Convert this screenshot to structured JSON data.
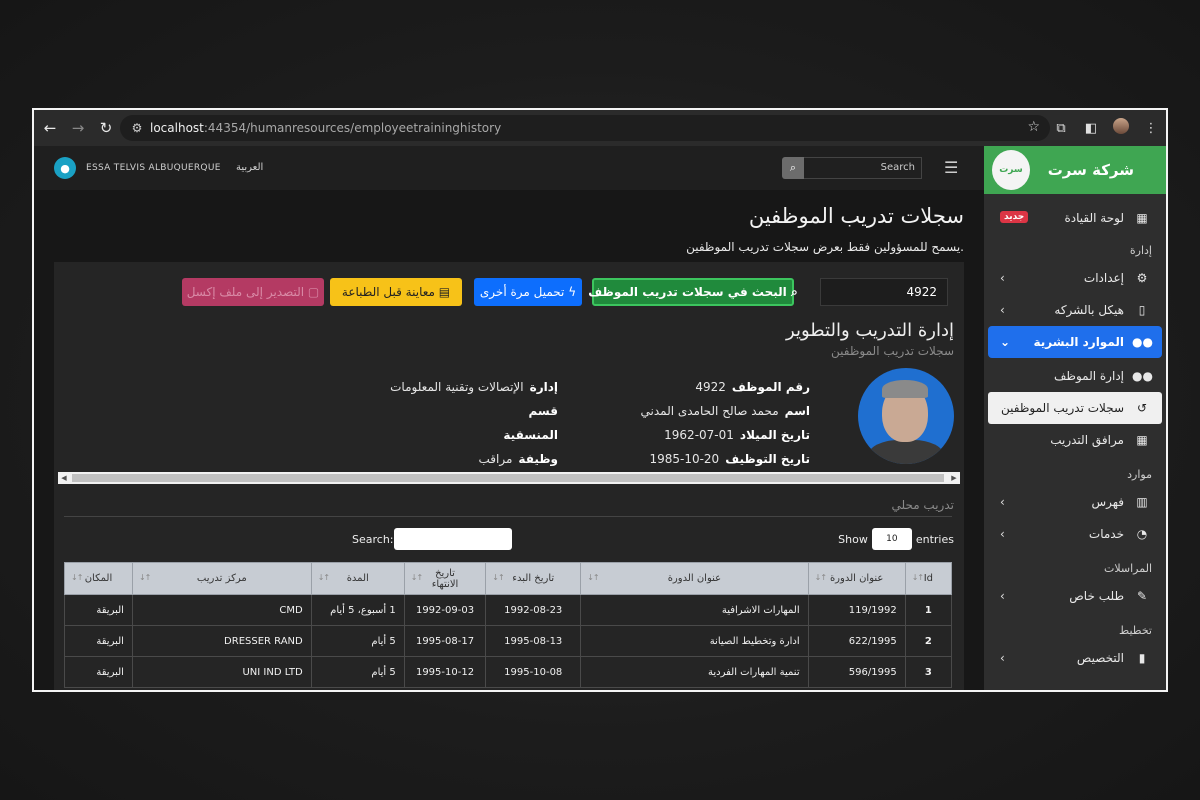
{
  "browser": {
    "url_host": "localhost",
    "url_path": ":44354/humanresources/employeetraininghistory"
  },
  "sidebar": {
    "brand": "شركة سرت",
    "logo_text": "سرت",
    "dashboard": {
      "label": "لوحة القيادة",
      "badge": "جديد"
    },
    "sections": {
      "admin": "إدارة",
      "resources": "موارد",
      "correspondence": "المراسلات",
      "planning": "تخطيط"
    },
    "items": {
      "settings": "إعدادات",
      "structure": "هيكل بالشركه",
      "hr": "الموارد البشرية",
      "employee_mgmt": "إدارة الموظف",
      "training_records": "سجلات تدريب الموظفين",
      "training_facilities": "مرافق التدريب",
      "index": "فهرس",
      "services": "خدمات",
      "special_request": "طلب خاص",
      "allocation": "التخصيص"
    }
  },
  "topnav": {
    "user_name": "ESSA TELVIS ALBUQUERQUE",
    "language": "العربية",
    "search_placeholder": "Search"
  },
  "page": {
    "title": "سجلات تدريب الموظفين",
    "subtitle": "يسمح للمسؤولين فقط بعرض سجلات تدريب الموظفين."
  },
  "toolbar": {
    "employee_number": "4922",
    "search_button": "البحث في سجلات تدريب الموظف",
    "reload_button": "تحميل مرة أخرى",
    "print_button": "معاينة قبل الطباعة",
    "export_button": "التصدير إلى ملف إكسل"
  },
  "profile": {
    "org_title": "إدارة التدريب والتطوير",
    "org_subtitle": "سجلات تدريب الموظفين",
    "emp_no_label": "رقم الموظف",
    "emp_no": "4922",
    "name_label": "اسم",
    "name": "محمد صالح الحامدى المدني",
    "dob_label": "تاريخ الميلاد",
    "dob": "1962-07-01",
    "hire_label": "تاريخ التوظيف",
    "hire": "1985-10-20",
    "dept_label": "إدارة",
    "dept": "الإتصالات وتقنية المعلومات",
    "section_label": "قسم",
    "section": "",
    "coord_label": "المنسقية",
    "coord": "",
    "job_label": "وظيفة",
    "job": "مراقب"
  },
  "local_training": {
    "title": "تدريب محلي",
    "show_label": "Show",
    "entries_value": "10",
    "entries_label": "entries",
    "search_label": "Search:",
    "columns": [
      "Id",
      "عنوان الدورة",
      "عنوان الدورة",
      "تاريخ البدء",
      "تاريخ الانتهاء",
      "المدة",
      "مركز تدريب",
      "المكان"
    ],
    "rows": [
      [
        "1",
        "119/1992",
        "المهارات الاشرافية",
        "1992-08-23",
        "1992-09-03",
        "1 أسبوع، 5 أيام",
        "CMD",
        "البريقة"
      ],
      [
        "2",
        "622/1995",
        "ادارة وتخطيط الصيانة",
        "1995-08-13",
        "1995-08-17",
        "5 أيام",
        "DRESSER RAND",
        "البريقة"
      ],
      [
        "3",
        "596/1995",
        "تنمية المهارات الفردية",
        "1995-10-08",
        "1995-10-12",
        "5 أيام",
        "UNI IND LTD",
        "البريقة"
      ]
    ]
  }
}
